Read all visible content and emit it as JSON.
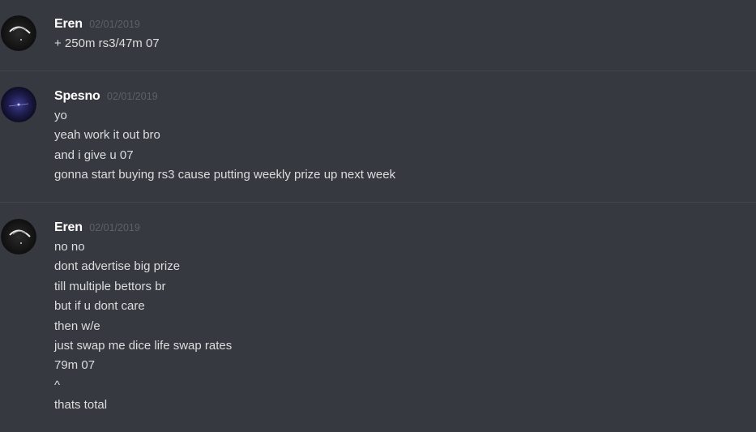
{
  "messages": [
    {
      "author": "Eren",
      "timestamp": "02/01/2019",
      "avatar_icon": "dark-orb-avatar",
      "lines": [
        "+ 250m rs3/47m 07"
      ]
    },
    {
      "author": "Spesno",
      "timestamp": "02/01/2019",
      "avatar_icon": "purple-space-avatar",
      "lines": [
        "yo",
        "yeah work it out bro",
        "and i give u 07",
        "gonna start buying rs3 cause putting weekly prize up next week"
      ]
    },
    {
      "author": "Eren",
      "timestamp": "02/01/2019",
      "avatar_icon": "dark-orb-avatar",
      "lines": [
        "no no",
        "dont advertise big prize",
        "till multiple bettors br",
        "but if u dont care",
        "then w/e",
        "just swap me dice life swap rates",
        "79m 07",
        "^",
        "thats total"
      ]
    }
  ],
  "colors": {
    "background": "#36393f",
    "divider": "#42454a",
    "username": "#ffffff",
    "timestamp": "#5d6065",
    "message_text": "#dcddde"
  }
}
